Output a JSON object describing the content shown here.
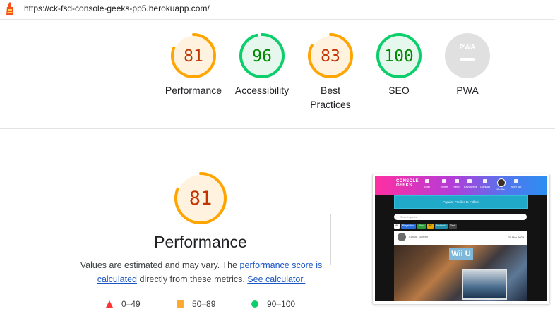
{
  "header": {
    "url": "https://ck-fsd-console-geeks-pp5.herokuapp.com/",
    "icon": "lighthouse-icon"
  },
  "colors": {
    "average": "#ffa400",
    "average_bg": "#fff3e0",
    "average_text": "#c33300",
    "pass": "#0cce6b",
    "pass_bg": "#e6f8ee",
    "pass_text": "#008800",
    "na": "#e0e0e0",
    "na_text": "#9e9e9e"
  },
  "gauges": [
    {
      "score": "81",
      "value": 81,
      "label": "Performance",
      "status": "average"
    },
    {
      "score": "96",
      "value": 96,
      "label": "Accessibility",
      "status": "pass"
    },
    {
      "score": "83",
      "value": 83,
      "label": "Best Practices",
      "status": "average"
    },
    {
      "score": "100",
      "value": 100,
      "label": "SEO",
      "status": "pass"
    },
    {
      "score": "",
      "value": 0,
      "label": "PWA",
      "status": "na",
      "icon_text": "PWA"
    }
  ],
  "performance": {
    "score": "81",
    "value": 81,
    "title": "Performance",
    "desc_before": "Values are estimated and may vary. The ",
    "link1": "performance score is calculated",
    "desc_middle": " directly from these metrics. ",
    "link2": "See calculator."
  },
  "legend": [
    {
      "range": "0–49",
      "icon": "fail-triangle-icon"
    },
    {
      "range": "50–89",
      "icon": "average-square-icon"
    },
    {
      "range": "90–100",
      "icon": "pass-circle-icon"
    }
  ],
  "screenshot": {
    "logo_line1": "CONSOLE",
    "logo_line2": "GEEKS",
    "nav": [
      "post",
      "Home",
      "Feed",
      "Favourites",
      "Contact",
      "Profile",
      "Sign out"
    ],
    "popular": "Popular Profiles to Follow!",
    "search_placeholder": "Search posts",
    "tags": [
      "All",
      "Playstation",
      "Xbox",
      "PC",
      "Nintendo",
      "Tech"
    ],
    "post_user": "Cathal_sullivan",
    "post_date": "20 Mar 2023",
    "post_image_text": "Wii U"
  }
}
